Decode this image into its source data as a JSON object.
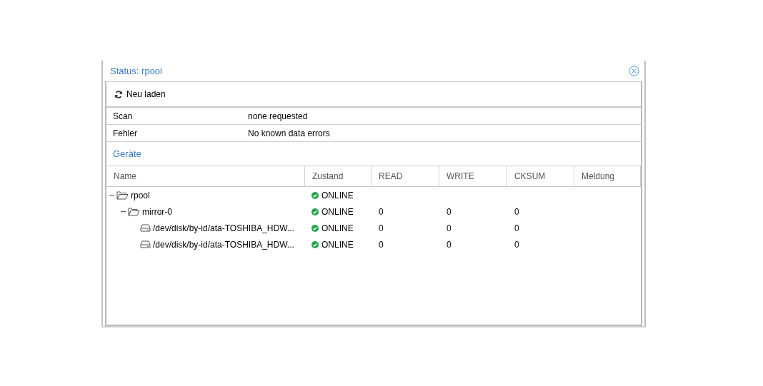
{
  "window": {
    "title": "Status: rpool"
  },
  "toolbar": {
    "reload_button": "Neu laden"
  },
  "info_rows": [
    {
      "label": "Scan",
      "value": "none requested"
    },
    {
      "label": "Fehler",
      "value": "No known data errors"
    }
  ],
  "devices_title": "Geräte",
  "table": {
    "columns": [
      "Name",
      "Zustand",
      "READ",
      "WRITE",
      "CKSUM",
      "Meldung"
    ],
    "rows": [
      {
        "kind": "folder",
        "expanded": true,
        "name": "rpool",
        "state": "ONLINE",
        "children": [
          {
            "kind": "folder",
            "expanded": true,
            "name": "mirror-0",
            "state": "ONLINE",
            "read": "0",
            "write": "0",
            "cksum": "0",
            "children": [
              {
                "kind": "disk",
                "name": "/dev/disk/by-id/ata-TOSHIBA_HDW...",
                "state": "ONLINE",
                "read": "0",
                "write": "0",
                "cksum": "0"
              },
              {
                "kind": "disk",
                "name": "/dev/disk/by-id/ata-TOSHIBA_HDW...",
                "state": "ONLINE",
                "read": "0",
                "write": "0",
                "cksum": "0"
              }
            ]
          }
        ]
      }
    ]
  }
}
